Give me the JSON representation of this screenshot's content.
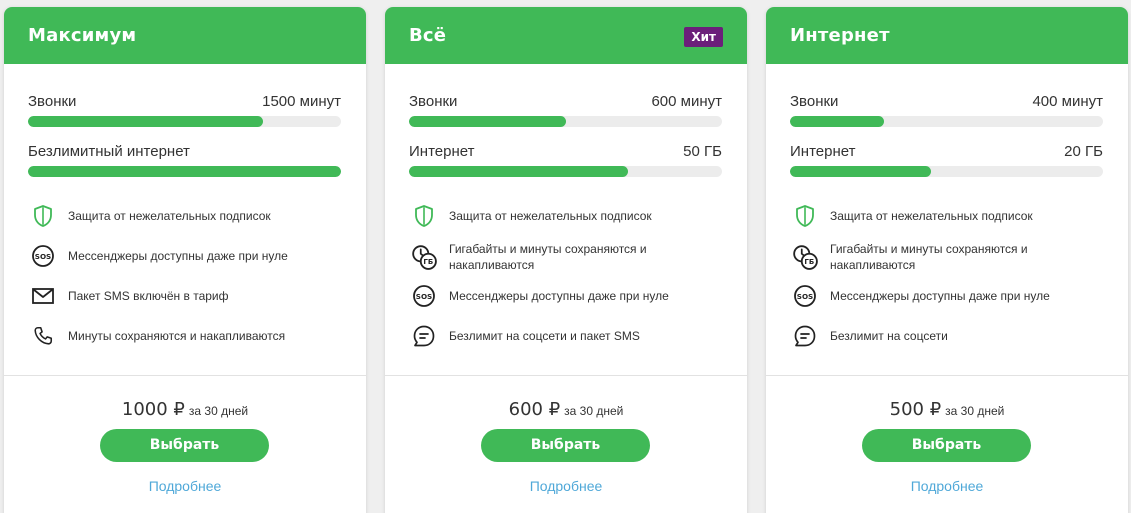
{
  "tariffs": [
    {
      "name": "Максимум",
      "badge": "",
      "meters": [
        {
          "label": "Звонки",
          "value": "1500 минут",
          "fill": 0.75
        },
        {
          "label": "Безлимитный интернет",
          "value": "",
          "fill": 1.0
        }
      ],
      "features": [
        {
          "icon": "shield-icon",
          "text": "Защита от нежелательных подписок"
        },
        {
          "icon": "sos-icon",
          "text": "Мессенджеры доступны даже при нуле"
        },
        {
          "icon": "envelope-icon",
          "text": "Пакет SMS включён в тариф"
        },
        {
          "icon": "phone-icon",
          "text": "Минуты сохраняются и накапливаются"
        }
      ],
      "price": "1000 ₽",
      "period": "за 30 дней",
      "button": "Выбрать",
      "more": "Подробнее"
    },
    {
      "name": "Всё",
      "badge": "Хит",
      "meters": [
        {
          "label": "Звонки",
          "value": "600 минут",
          "fill": 0.5
        },
        {
          "label": "Интернет",
          "value": "50 ГБ",
          "fill": 0.7
        }
      ],
      "features": [
        {
          "icon": "shield-icon",
          "text": "Защита от нежелательных подписок"
        },
        {
          "icon": "rollover-icon",
          "text": "Гигабайты и минуты сохраняются и накапливаются"
        },
        {
          "icon": "sos-icon",
          "text": "Мессенджеры доступны даже при нуле"
        },
        {
          "icon": "chat-icon",
          "text": "Безлимит на соцсети и пакет SMS"
        }
      ],
      "price": "600 ₽",
      "period": "за 30 дней",
      "button": "Выбрать",
      "more": "Подробнее"
    },
    {
      "name": "Интернет",
      "badge": "",
      "meters": [
        {
          "label": "Звонки",
          "value": "400 минут",
          "fill": 0.3
        },
        {
          "label": "Интернет",
          "value": "20 ГБ",
          "fill": 0.45
        }
      ],
      "features": [
        {
          "icon": "shield-icon",
          "text": "Защита от нежелательных подписок"
        },
        {
          "icon": "rollover-icon",
          "text": "Гигабайты и минуты сохраняются и накапливаются"
        },
        {
          "icon": "sos-icon",
          "text": "Мессенджеры доступны даже при нуле"
        },
        {
          "icon": "chat-icon",
          "text": "Безлимит на соцсети"
        }
      ],
      "price": "500 ₽",
      "period": "за 30 дней",
      "button": "Выбрать",
      "more": "Подробнее"
    }
  ],
  "colors": {
    "accent": "#40b957",
    "badge": "#6b1f7a",
    "link": "#4fa8d8",
    "track": "#ececec"
  }
}
